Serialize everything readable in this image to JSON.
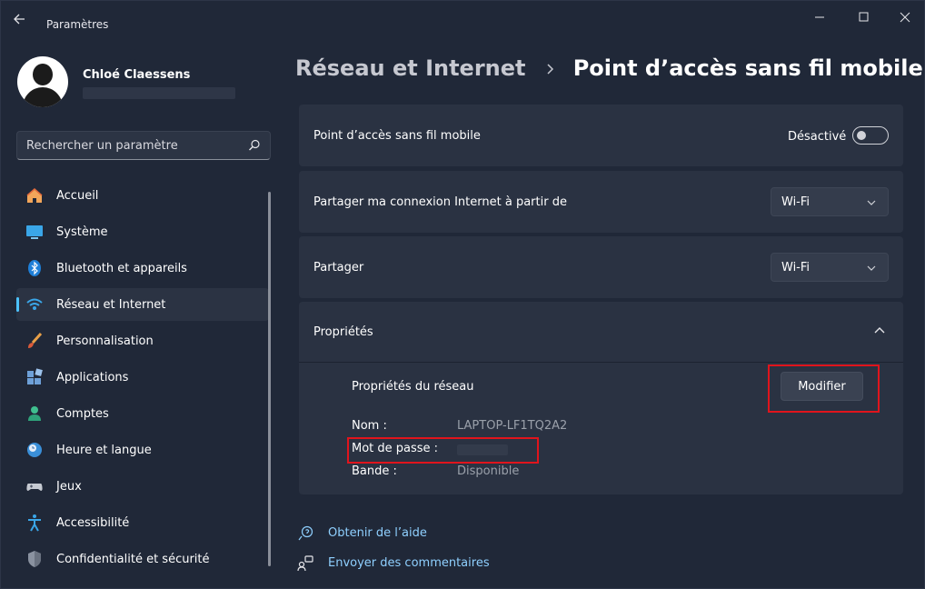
{
  "window": {
    "title": "Paramètres"
  },
  "user": {
    "name": "Chloé Claessens"
  },
  "search": {
    "placeholder": "Rechercher un paramètre"
  },
  "sidebar": {
    "items": [
      {
        "label": "Accueil",
        "icon": "home-icon"
      },
      {
        "label": "Système",
        "icon": "display-icon"
      },
      {
        "label": "Bluetooth et appareils",
        "icon": "bluetooth-icon"
      },
      {
        "label": "Réseau et Internet",
        "icon": "wifi-icon",
        "active": true
      },
      {
        "label": "Personnalisation",
        "icon": "brush-icon"
      },
      {
        "label": "Applications",
        "icon": "apps-icon"
      },
      {
        "label": "Comptes",
        "icon": "account-icon"
      },
      {
        "label": "Heure et langue",
        "icon": "clock-globe-icon"
      },
      {
        "label": "Jeux",
        "icon": "gamepad-icon"
      },
      {
        "label": "Accessibilité",
        "icon": "accessibility-icon"
      },
      {
        "label": "Confidentialité et sécurité",
        "icon": "shield-icon"
      }
    ]
  },
  "breadcrumb": {
    "parent": "Réseau et Internet",
    "current": "Point d’accès sans fil mobile"
  },
  "hotspot": {
    "label": "Point d’accès sans fil mobile",
    "state": "Désactivé",
    "enabled": false
  },
  "share_from": {
    "label": "Partager ma connexion Internet à partir de",
    "value": "Wi-Fi"
  },
  "share_over": {
    "label": "Partager",
    "value": "Wi-Fi"
  },
  "properties": {
    "title": "Propriétés",
    "expanded": true,
    "network_title": "Propriétés du réseau",
    "modify_label": "Modifier",
    "name_key": "Nom :",
    "name_value": "LAPTOP-LF1TQ2A2",
    "password_key": "Mot de passe :",
    "band_key": "Bande :",
    "band_value": "Disponible"
  },
  "links": {
    "help": "Obtenir de l’aide",
    "feedback": "Envoyer des commentaires"
  },
  "colors": {
    "accent": "#4cc2ff",
    "link": "#8fd0ff",
    "highlight": "#e0141c",
    "background": "#202838",
    "card": "#2a3242"
  }
}
